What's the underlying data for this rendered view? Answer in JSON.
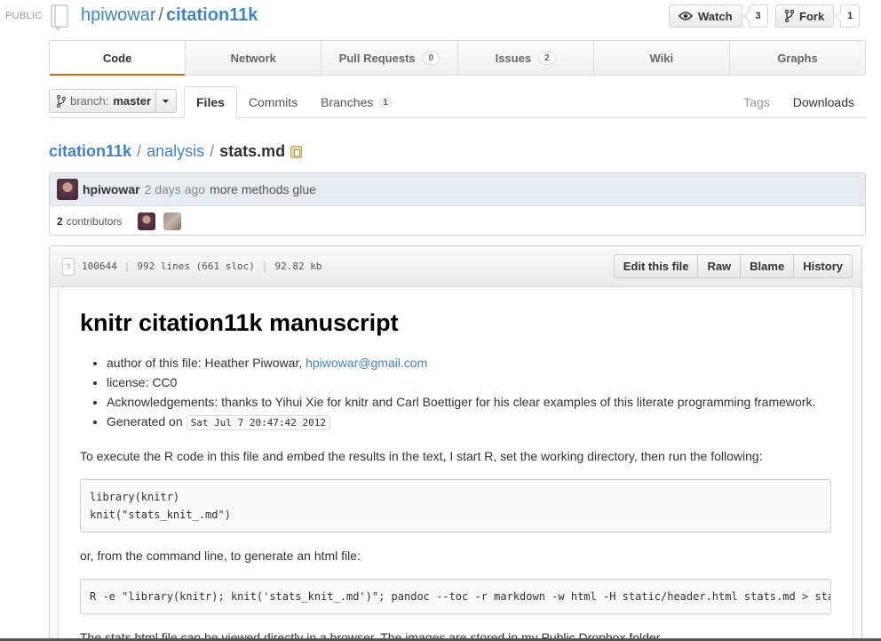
{
  "header": {
    "visibility": "PUBLIC",
    "owner": "hpiwowar",
    "separator": "/",
    "repo": "citation11k",
    "watch_label": "Watch",
    "watch_count": "3",
    "fork_label": "Fork",
    "fork_count": "1"
  },
  "tabs": [
    {
      "label": "Code"
    },
    {
      "label": "Network"
    },
    {
      "label": "Pull Requests",
      "count": "0"
    },
    {
      "label": "Issues",
      "count": "2"
    },
    {
      "label": "Wiki"
    },
    {
      "label": "Graphs"
    }
  ],
  "branch": {
    "label": "branch:",
    "value": "master"
  },
  "subnav": {
    "files": "Files",
    "commits": "Commits",
    "branches": "Branches",
    "branches_count": "1",
    "tags": "Tags",
    "downloads": "Downloads"
  },
  "breadcrumb": {
    "root": "citation11k",
    "dir": "analysis",
    "file": "stats.md",
    "slash": "/"
  },
  "commit": {
    "author": "hpiwowar",
    "age": "2 days ago",
    "message": "more methods glue",
    "contributors_count": "2",
    "contributors_label": "contributors"
  },
  "file": {
    "mode": "100644",
    "lines": "992 lines (661 sloc)",
    "size": "92.82 kb",
    "actions": {
      "edit": "Edit this file",
      "raw": "Raw",
      "blame": "Blame",
      "history": "History"
    }
  },
  "markdown": {
    "title": "knitr citation11k manuscript",
    "bullets": {
      "author_prefix": "author of this file: Heather Piwowar, ",
      "author_email": "hpiwowar@gmail.com",
      "license": "license: CC0",
      "ack": "Acknowledgements: thanks to Yihui Xie for knitr and Carl Boettiger for his clear examples of this literate programming framework.",
      "generated_prefix": "Generated on",
      "generated_date": "Sat Jul 7 20:47:42 2012"
    },
    "para1": "To execute the R code in this file and embed the results in the text, I start R, set the working directory, then run the following:",
    "code1": "library(knitr)\nknit(\"stats_knit_.md\")",
    "para2": "or, from the command line, to generate an html file:",
    "code2": "R -e \"library(knitr); knit('stats_knit_.md')\"; pandoc --toc -r markdown -w html -H static/header.html stats.md > stats.html",
    "para3": "The stats.html file can be viewed directly in a browser. The images are stored in my Public Dropbox folder."
  }
}
